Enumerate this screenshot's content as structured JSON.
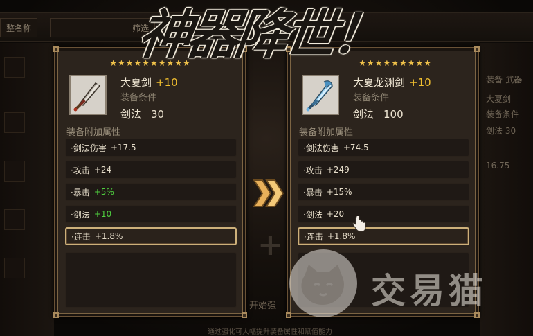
{
  "title": "神器降世！",
  "background": {
    "top_tabs": [
      "整名称",
      "筛选"
    ],
    "right_panel": {
      "line1": "装备-武器",
      "line2": "大夏剑",
      "line3": "装备条件",
      "line4": "剑法 30",
      "line5": "16.75"
    },
    "center_hint": "开始强",
    "bottom_hint": "通过强化可大幅提升装备属性和赋值能力"
  },
  "left_card": {
    "stars": "★★★★★★★★★★",
    "name": "大夏剑",
    "plus": "+10",
    "req_label": "装备条件",
    "req_skill": "剑法",
    "req_value": "30",
    "attr_title": "装备附加属性",
    "attrs": [
      {
        "label": "·剑法伤害",
        "value": "+17.5",
        "color": "normal"
      },
      {
        "label": "·攻击",
        "value": "+24",
        "color": "normal"
      },
      {
        "label": "·暴击",
        "value": "+5%",
        "color": "green"
      },
      {
        "label": "·剑法",
        "value": "+10",
        "color": "green"
      },
      {
        "label": "·连击",
        "value": "+1.8%",
        "color": "normal"
      }
    ]
  },
  "right_card": {
    "stars": "★★★★★★★★★",
    "name": "大夏龙渊剑",
    "plus": "+10",
    "req_label": "装备条件",
    "req_skill": "剑法",
    "req_value": "100",
    "attr_title": "装备附加属性",
    "attrs": [
      {
        "label": "·剑法伤害",
        "value": "+74.5"
      },
      {
        "label": "·攻击",
        "value": "+249"
      },
      {
        "label": "·暴击",
        "value": "+15%"
      },
      {
        "label": "·剑法",
        "value": "+20"
      },
      {
        "label": "·连击",
        "value": "+1.8%"
      }
    ]
  },
  "watermark": "交易猫",
  "colors": {
    "plus_gold": "#f1bf2f",
    "green_stat": "#4fcf3f",
    "frame_gold": "#a98a5c",
    "arrow": "#e8b05a"
  }
}
